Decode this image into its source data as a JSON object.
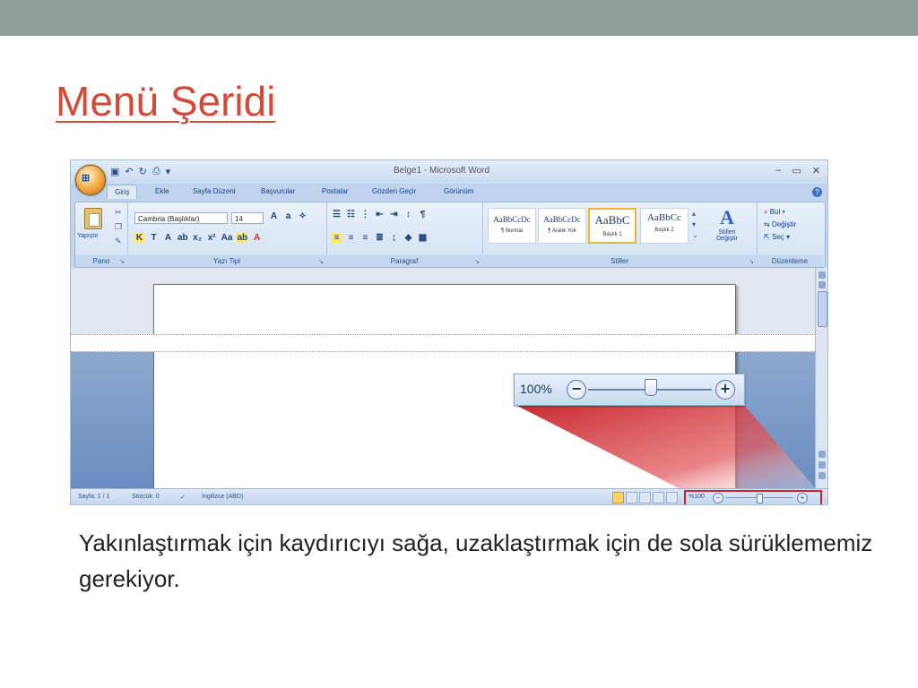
{
  "slide": {
    "title": "Menü Şeridi",
    "caption": "Yakınlaştırmak için kaydırıcıyı sağa, uzaklaştırmak için de sola sürüklememiz gerekiyor."
  },
  "word": {
    "window_title": "Belge1 - Microsoft Word",
    "office_button_label": "Office",
    "tabs": [
      "Giriş",
      "Ekle",
      "Sayfa Düzeni",
      "Başvurular",
      "Postalar",
      "Gözden Geçir",
      "Görünüm"
    ],
    "active_tab": "Giriş",
    "groups": {
      "clipboard": {
        "label": "Pano",
        "paste": "Yapıştır"
      },
      "font": {
        "label": "Yazı Tipi",
        "font_name": "Cambria (Başlıklar)",
        "font_size": "14"
      },
      "paragraph": {
        "label": "Paragraf"
      },
      "styles": {
        "label": "Stiller",
        "items": [
          {
            "sample": "AaBbCcDc",
            "name": "¶ Normal"
          },
          {
            "sample": "AaBbCcDc",
            "name": "¶ Aralık Yok"
          },
          {
            "sample": "AaBbC",
            "name": "Başlık 1"
          },
          {
            "sample": "AaBbCc",
            "name": "Başlık 2"
          }
        ],
        "change_styles": "Stilleri Değiştir"
      },
      "editing": {
        "label": "Düzenleme",
        "find": "Bul",
        "replace": "Değiştir",
        "select": "Seç"
      }
    },
    "status": {
      "page": "Sayfa: 1 / 1",
      "words": "Sözcük: 0",
      "language": "İngilizce (ABD)"
    },
    "zoom": {
      "percent_small": "%100",
      "percent_large": "100%",
      "level": 0.5
    }
  },
  "colors": {
    "title": "#d14b3a",
    "highlight": "#c8232c",
    "topbar": "#909e9a"
  }
}
